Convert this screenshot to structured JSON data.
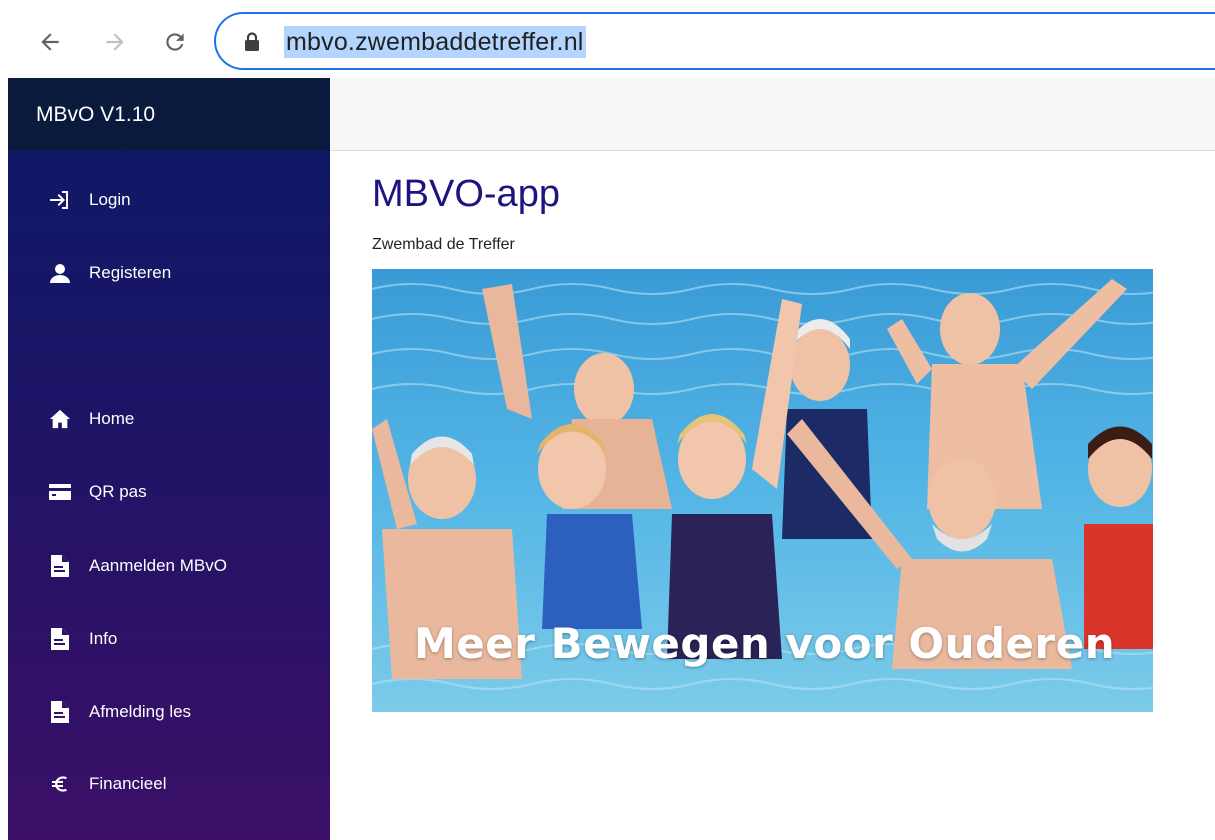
{
  "browser": {
    "url": "mbvo.zwembaddetreffer.nl"
  },
  "sidebar": {
    "brand": "MBvO V1.10",
    "items": [
      {
        "label": "Login",
        "icon": "login-icon"
      },
      {
        "label": "Registeren",
        "icon": "user-icon"
      },
      {
        "label": "Home",
        "icon": "home-icon"
      },
      {
        "label": "QR pas",
        "icon": "card-icon"
      },
      {
        "label": "Aanmelden MBvO",
        "icon": "document-icon"
      },
      {
        "label": "Info",
        "icon": "document-icon"
      },
      {
        "label": "Afmelding les",
        "icon": "document-icon"
      },
      {
        "label": "Financieel",
        "icon": "euro-icon"
      }
    ]
  },
  "main": {
    "title": "MBVO-app",
    "subtitle": "Zwembad de Treffer",
    "hero_caption": "Meer Bewegen voor Ouderen"
  },
  "colors": {
    "sidebar_top": "#0a1a3c",
    "sidebar_gradient_start": "#0c1a66",
    "sidebar_gradient_end": "#3b0f67",
    "title": "#1d1480",
    "omnibox_border": "#1a73e8",
    "url_highlight": "#b4d5fe"
  }
}
